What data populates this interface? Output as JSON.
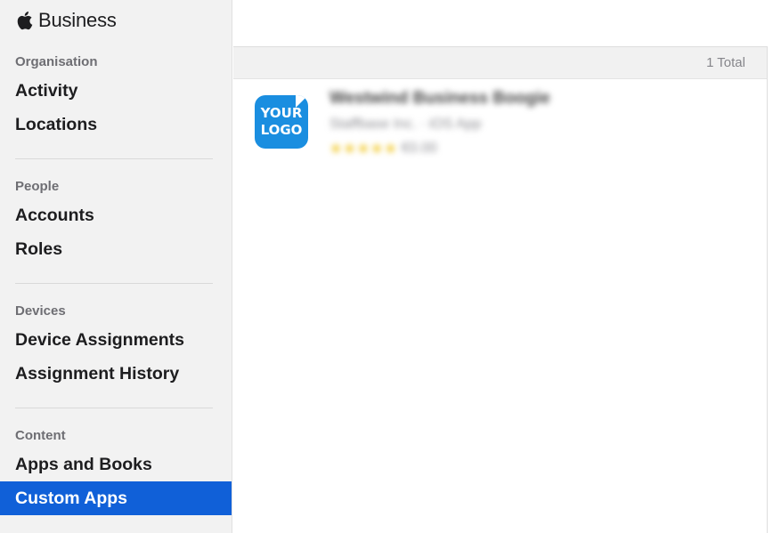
{
  "sidebar": {
    "brand": "Business",
    "sections": [
      {
        "title": "Organisation",
        "items": [
          "Activity",
          "Locations"
        ]
      },
      {
        "title": "People",
        "items": [
          "Accounts",
          "Roles"
        ]
      },
      {
        "title": "Devices",
        "items": [
          "Device Assignments",
          "Assignment History"
        ]
      },
      {
        "title": "Content",
        "items": [
          "Apps and Books",
          "Custom Apps"
        ]
      }
    ],
    "active_item": "Custom Apps"
  },
  "main": {
    "total_label": "1 Total",
    "apps": [
      {
        "icon_text": "YOUR\nLOGO",
        "name": "Westwind Business Boogie",
        "developer": "Staffbase Inc. · iOS App",
        "stars": "★★★★★",
        "price": "€0.00"
      }
    ]
  },
  "colors": {
    "accent": "#1060d8",
    "sidebar_bg": "#f2f2f2",
    "logo_bg": "#1a8ee0",
    "star": "#f0c419"
  }
}
